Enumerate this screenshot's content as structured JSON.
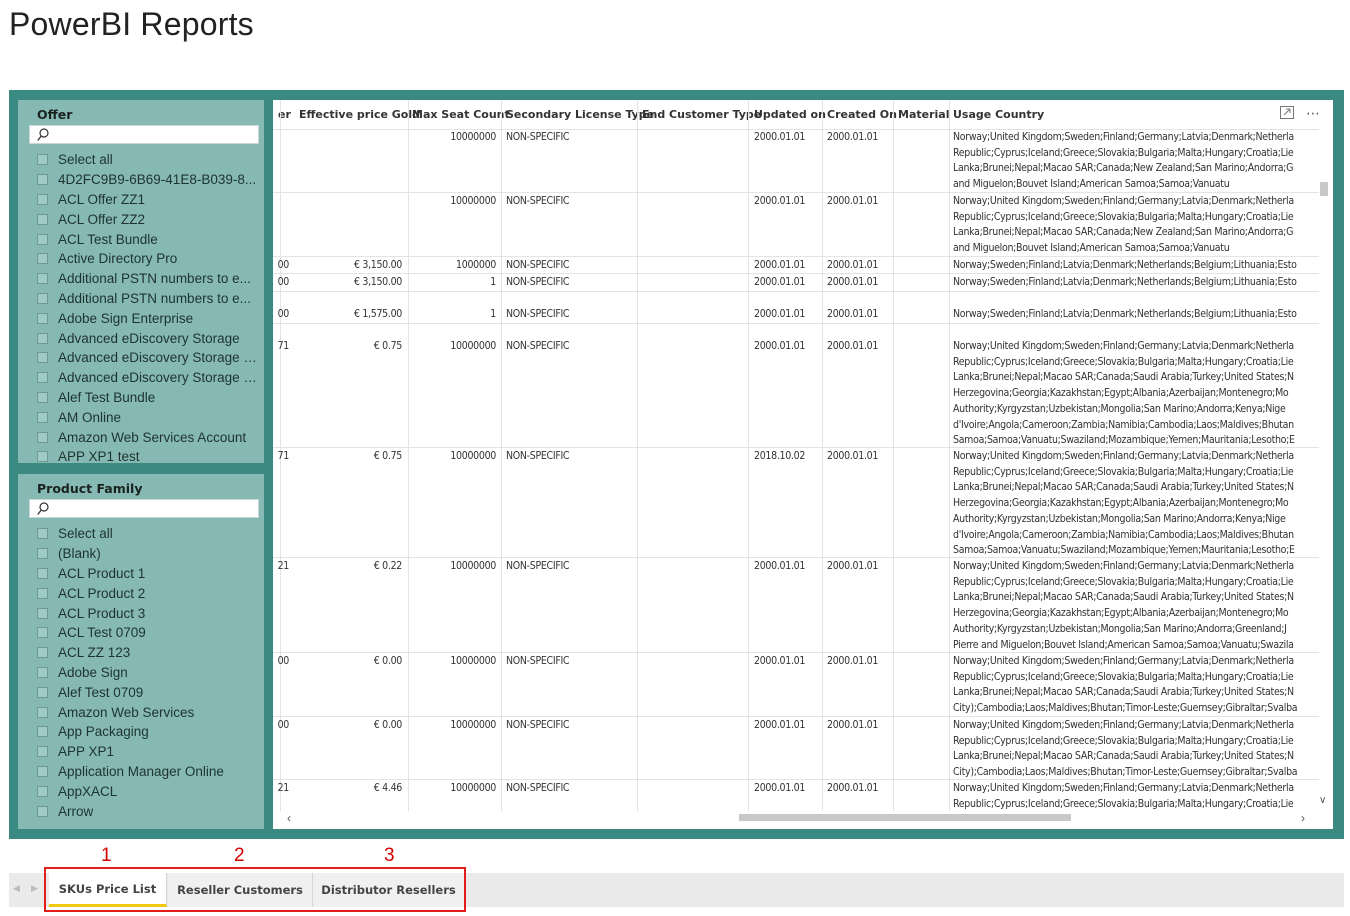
{
  "page": {
    "title": "PowerBI Reports"
  },
  "slicers": {
    "offer": {
      "title": "Offer",
      "search_placeholder": "",
      "items": [
        "Select all",
        "4D2FC9B9-6B69-41E8-B039-8...",
        "ACL Offer ZZ1",
        "ACL Offer ZZ2",
        "ACL Test Bundle",
        "Active Directory Pro",
        "Additional PSTN numbers to e...",
        "Additional PSTN numbers to e...",
        "Adobe Sign Enterprise",
        "Advanced eDiscovery Storage",
        "Advanced eDiscovery Storage (...",
        "Advanced eDiscovery Storage f...",
        "Alef Test Bundle",
        "AM Online",
        "Amazon Web Services Account",
        "APP XP1 test"
      ]
    },
    "family": {
      "title": "Product Family",
      "search_placeholder": "",
      "items": [
        "Select all",
        "(Blank)",
        "ACL Product 1",
        "ACL Product 2",
        "ACL Product 3",
        "ACL Test 0709",
        "ACL ZZ 123",
        "Adobe Sign",
        "Alef Test 0709",
        "Amazon Web Services",
        "App Packaging",
        "APP XP1",
        "Application Manager Online",
        "AppXACL",
        "Arrow"
      ]
    }
  },
  "table": {
    "headers": {
      "c0": "er",
      "c1": "Effective price Gold",
      "c2": "Max Seat Count",
      "c3": "Secondary License Type",
      "c4": "End Customer Type",
      "c5": "Updated on",
      "c6": "Created On",
      "c7": "Material",
      "c8": "Usage Country"
    },
    "rows": [
      {
        "c0": "",
        "c1": "",
        "c2": "10000000",
        "c3": "NON-SPECIFIC",
        "c5": "2000.01.01",
        "c6": "2000.01.01",
        "country": "Norway;United Kingdom;Sweden;Finland;Germany;Latvia;Denmark;Netherla\nRepublic;Cyprus;Iceland;Greece;Slovakia;Bulgaria;Malta;Hungary;Croatia;Lie\nLanka;Brunei;Nepal;Macao SAR;Canada;New Zealand;San Marino;Andorra;G\nand Miguelon;Bouvet Island;American Samoa;Samoa;Vanuatu"
      },
      {
        "c0": "",
        "c1": "",
        "c2": "10000000",
        "c3": "NON-SPECIFIC",
        "c5": "2000.01.01",
        "c6": "2000.01.01",
        "country": "Norway;United Kingdom;Sweden;Finland;Germany;Latvia;Denmark;Netherla\nRepublic;Cyprus;Iceland;Greece;Slovakia;Bulgaria;Malta;Hungary;Croatia;Lie\nLanka;Brunei;Nepal;Macao SAR;Canada;New Zealand;San Marino;Andorra;G\nand Miguelon;Bouvet Island;American Samoa;Samoa;Vanuatu"
      },
      {
        "c0": "00",
        "c1": "€ 3,150.00",
        "c2": "1000000",
        "c3": "NON-SPECIFIC",
        "c5": "2000.01.01",
        "c6": "2000.01.01",
        "country": "Norway;Sweden;Finland;Latvia;Denmark;Netherlands;Belgium;Lithuania;Esto"
      },
      {
        "c0": "00",
        "c1": "€ 3,150.00",
        "c2": "1",
        "c3": "NON-SPECIFIC",
        "c5": "2000.01.01",
        "c6": "2000.01.01",
        "country": "Norway;Sweden;Finland;Latvia;Denmark;Netherlands;Belgium;Lithuania;Esto"
      },
      {
        "c0": "00",
        "c1": "€ 1,575.00",
        "c2": "1",
        "c3": "NON-SPECIFIC",
        "c5": "2000.01.01",
        "c6": "2000.01.01",
        "country": "Norway;Sweden;Finland;Latvia;Denmark;Netherlands;Belgium;Lithuania;Esto"
      },
      {
        "c0": "71",
        "c1": "€ 0.75",
        "c2": "10000000",
        "c3": "NON-SPECIFIC",
        "c5": "2000.01.01",
        "c6": "2000.01.01",
        "country": "Norway;United Kingdom;Sweden;Finland;Germany;Latvia;Denmark;Netherla\nRepublic;Cyprus;Iceland;Greece;Slovakia;Bulgaria;Malta;Hungary;Croatia;Lie\nLanka;Brunei;Nepal;Macao SAR;Canada;Saudi Arabia;Turkey;United States;N\nHerzegovina;Georgia;Kazakhstan;Egypt;Albania;Azerbaijan;Montenegro;Mo\nAuthority;Kyrgyzstan;Uzbekistan;Mongolia;San Marino;Andorra;Kenya;Nige\nd'Ivoire;Angola;Cameroon;Zambia;Namibia;Cambodia;Laos;Maldives;Bhutan\nSamoa;Samoa;Vanuatu;Swaziland;Mozambique;Yemen;Mauritania;Lesotho;E"
      },
      {
        "c0": "71",
        "c1": "€ 0.75",
        "c2": "10000000",
        "c3": "NON-SPECIFIC",
        "c5": "2018.10.02",
        "c6": "2000.01.01",
        "country": "Norway;United Kingdom;Sweden;Finland;Germany;Latvia;Denmark;Netherla\nRepublic;Cyprus;Iceland;Greece;Slovakia;Bulgaria;Malta;Hungary;Croatia;Lie\nLanka;Brunei;Nepal;Macao SAR;Canada;Saudi Arabia;Turkey;United States;N\nHerzegovina;Georgia;Kazakhstan;Egypt;Albania;Azerbaijan;Montenegro;Mo\nAuthority;Kyrgyzstan;Uzbekistan;Mongolia;San Marino;Andorra;Kenya;Nige\nd'Ivoire;Angola;Cameroon;Zambia;Namibia;Cambodia;Laos;Maldives;Bhutan\nSamoa;Samoa;Vanuatu;Swaziland;Mozambique;Yemen;Mauritania;Lesotho;E"
      },
      {
        "c0": "21",
        "c1": "€ 0.22",
        "c2": "10000000",
        "c3": "NON-SPECIFIC",
        "c5": "2000.01.01",
        "c6": "2000.01.01",
        "country": "Norway;United Kingdom;Sweden;Finland;Germany;Latvia;Denmark;Netherla\nRepublic;Cyprus;Iceland;Greece;Slovakia;Bulgaria;Malta;Hungary;Croatia;Lie\nLanka;Brunei;Nepal;Macao SAR;Canada;Saudi Arabia;Turkey;United States;N\nHerzegovina;Georgia;Kazakhstan;Egypt;Albania;Azerbaijan;Montenegro;Mo\nAuthority;Kyrgyzstan;Uzbekistan;Mongolia;San Marino;Andorra;Greenland;J\nPierre and Miguelon;Bouvet Island;American Samoa;Samoa;Vanuatu;Swazila"
      },
      {
        "c0": "00",
        "c1": "€ 0.00",
        "c2": "10000000",
        "c3": "NON-SPECIFIC",
        "c5": "2000.01.01",
        "c6": "2000.01.01",
        "country": "Norway;United Kingdom;Sweden;Finland;Germany;Latvia;Denmark;Netherla\nRepublic;Cyprus;Iceland;Greece;Slovakia;Bulgaria;Malta;Hungary;Croatia;Lie\nLanka;Brunei;Nepal;Macao SAR;Canada;Saudi Arabia;Turkey;United States;N\nCity);Cambodia;Laos;Maldives;Bhutan;Timor-Leste;Guernsey;Gibraltar;Svalba"
      },
      {
        "c0": "00",
        "c1": "€ 0.00",
        "c2": "10000000",
        "c3": "NON-SPECIFIC",
        "c5": "2000.01.01",
        "c6": "2000.01.01",
        "country": "Norway;United Kingdom;Sweden;Finland;Germany;Latvia;Denmark;Netherla\nRepublic;Cyprus;Iceland;Greece;Slovakia;Bulgaria;Malta;Hungary;Croatia;Lie\nLanka;Brunei;Nepal;Macao SAR;Canada;Saudi Arabia;Turkey;United States;N\nCity);Cambodia;Laos;Maldives;Bhutan;Timor-Leste;Guernsey;Gibraltar;Svalba"
      },
      {
        "c0": "21",
        "c1": "€ 4.46",
        "c2": "10000000",
        "c3": "NON-SPECIFIC",
        "c5": "2000.01.01",
        "c6": "2000.01.01",
        "country": "Norway;United Kingdom;Sweden;Finland;Germany;Latvia;Denmark;Netherla\nRepublic;Cyprus;Iceland;Greece;Slovakia;Bulgaria;Malta;Hungary;Croatia;Lie"
      }
    ]
  },
  "tabs": [
    {
      "label": "SKUs Price List",
      "active": true
    },
    {
      "label": "Reseller Customers",
      "active": false
    },
    {
      "label": "Distributor Resellers",
      "active": false
    }
  ],
  "annotations": {
    "numbers": [
      "1",
      "2",
      "3"
    ],
    "color": "#e01e1e"
  },
  "icons": {
    "focus_mode": "focus-mode-icon",
    "more_options": "more-options-icon",
    "search": "search-icon"
  },
  "colors": {
    "frame": "#3b8a82",
    "slicer_bg": "#86b9b3",
    "active_tab_underline": "#f2c811"
  }
}
